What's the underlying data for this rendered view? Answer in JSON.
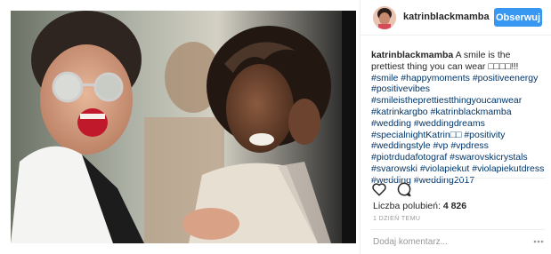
{
  "post": {
    "username": "katrinblackmamba",
    "follow_label": "Obserwuj",
    "caption": {
      "author": "katrinblackmamba",
      "text": "A smile is the prettiest thing you can wear □□□□!!!",
      "hashtags": [
        "#smile",
        "#happymoments",
        "#positiveenergy",
        "#positivevibes",
        "#smileistheprettiestthingyoucanwear",
        "#katrinkargbo",
        "#katrinblackmamba",
        "#wedding",
        "#weddingdreams",
        "#specialnightKatrin□□",
        "#positivity",
        "#weddingstyle",
        "#vp",
        "#vpdress",
        "#piotrdudafotograf",
        "#swarovskicrystals",
        "#svarowski",
        "#violapiekut",
        "#violapiekutdress",
        "#wedding",
        "#wedding2017"
      ]
    },
    "likes_label": "Liczba polubień:",
    "likes_count": "4 826",
    "time_ago": "1 DZIEŃ TEMU",
    "comment_placeholder": "Dodaj komentarz...",
    "icons": {
      "like": "heart-icon",
      "comment": "comment-bubble-icon",
      "more": "more-options-icon"
    },
    "colors": {
      "follow_button": "#3897f0",
      "hashtag": "#003569",
      "text": "#262626",
      "muted": "#999999",
      "divider": "#efefef"
    }
  }
}
